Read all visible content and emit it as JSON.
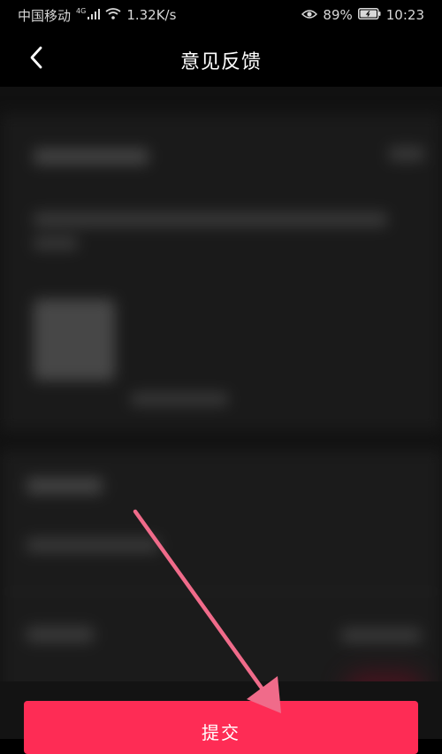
{
  "status_bar": {
    "carrier": "中国移动",
    "network_type": "4G",
    "speed": "1.32K/s",
    "battery_percent": "89%",
    "time": "10:23"
  },
  "header": {
    "title": "意见反馈",
    "back_icon": "chevron-left-icon"
  },
  "footer": {
    "submit_label": "提交"
  },
  "colors": {
    "accent": "#fe2c55",
    "annotation_arrow": "#f06b8a",
    "background": "#000000"
  }
}
